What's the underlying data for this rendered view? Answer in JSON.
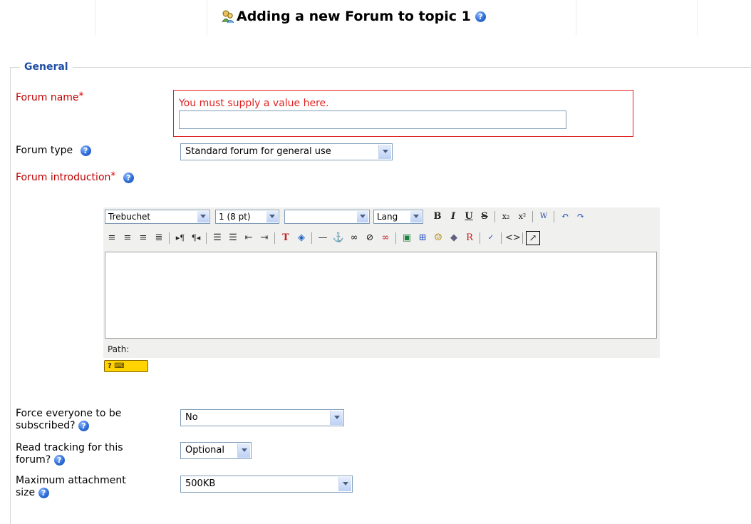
{
  "page": {
    "title": "Adding a new Forum to topic 1",
    "icon": "forum-icon"
  },
  "general": {
    "legend": "General"
  },
  "forum_name": {
    "label": "Forum name",
    "required_mark": "*",
    "error": "You must supply a value here.",
    "value": ""
  },
  "forum_type": {
    "label": "Forum type",
    "selected": "Standard forum for general use"
  },
  "forum_intro": {
    "label": "Forum introduction",
    "required_mark": "*"
  },
  "editor": {
    "font": "Trebuchet",
    "size": "1 (8 pt)",
    "style": "",
    "lang": "Lang",
    "path_label": "Path:",
    "keyboard_label": "? ⌨"
  },
  "force_subscribe": {
    "label_line1": "Force everyone to be",
    "label_line2": "subscribed?",
    "selected": "No"
  },
  "read_tracking": {
    "label_line1": "Read tracking for this",
    "label_line2": "forum?",
    "selected": "Optional"
  },
  "max_attachment": {
    "label_line1": "Maximum attachment",
    "label_line2": "size",
    "selected": "500KB"
  },
  "colors": {
    "required": "#c00000",
    "error": "#e02020",
    "legend": "#1f4ea6"
  }
}
